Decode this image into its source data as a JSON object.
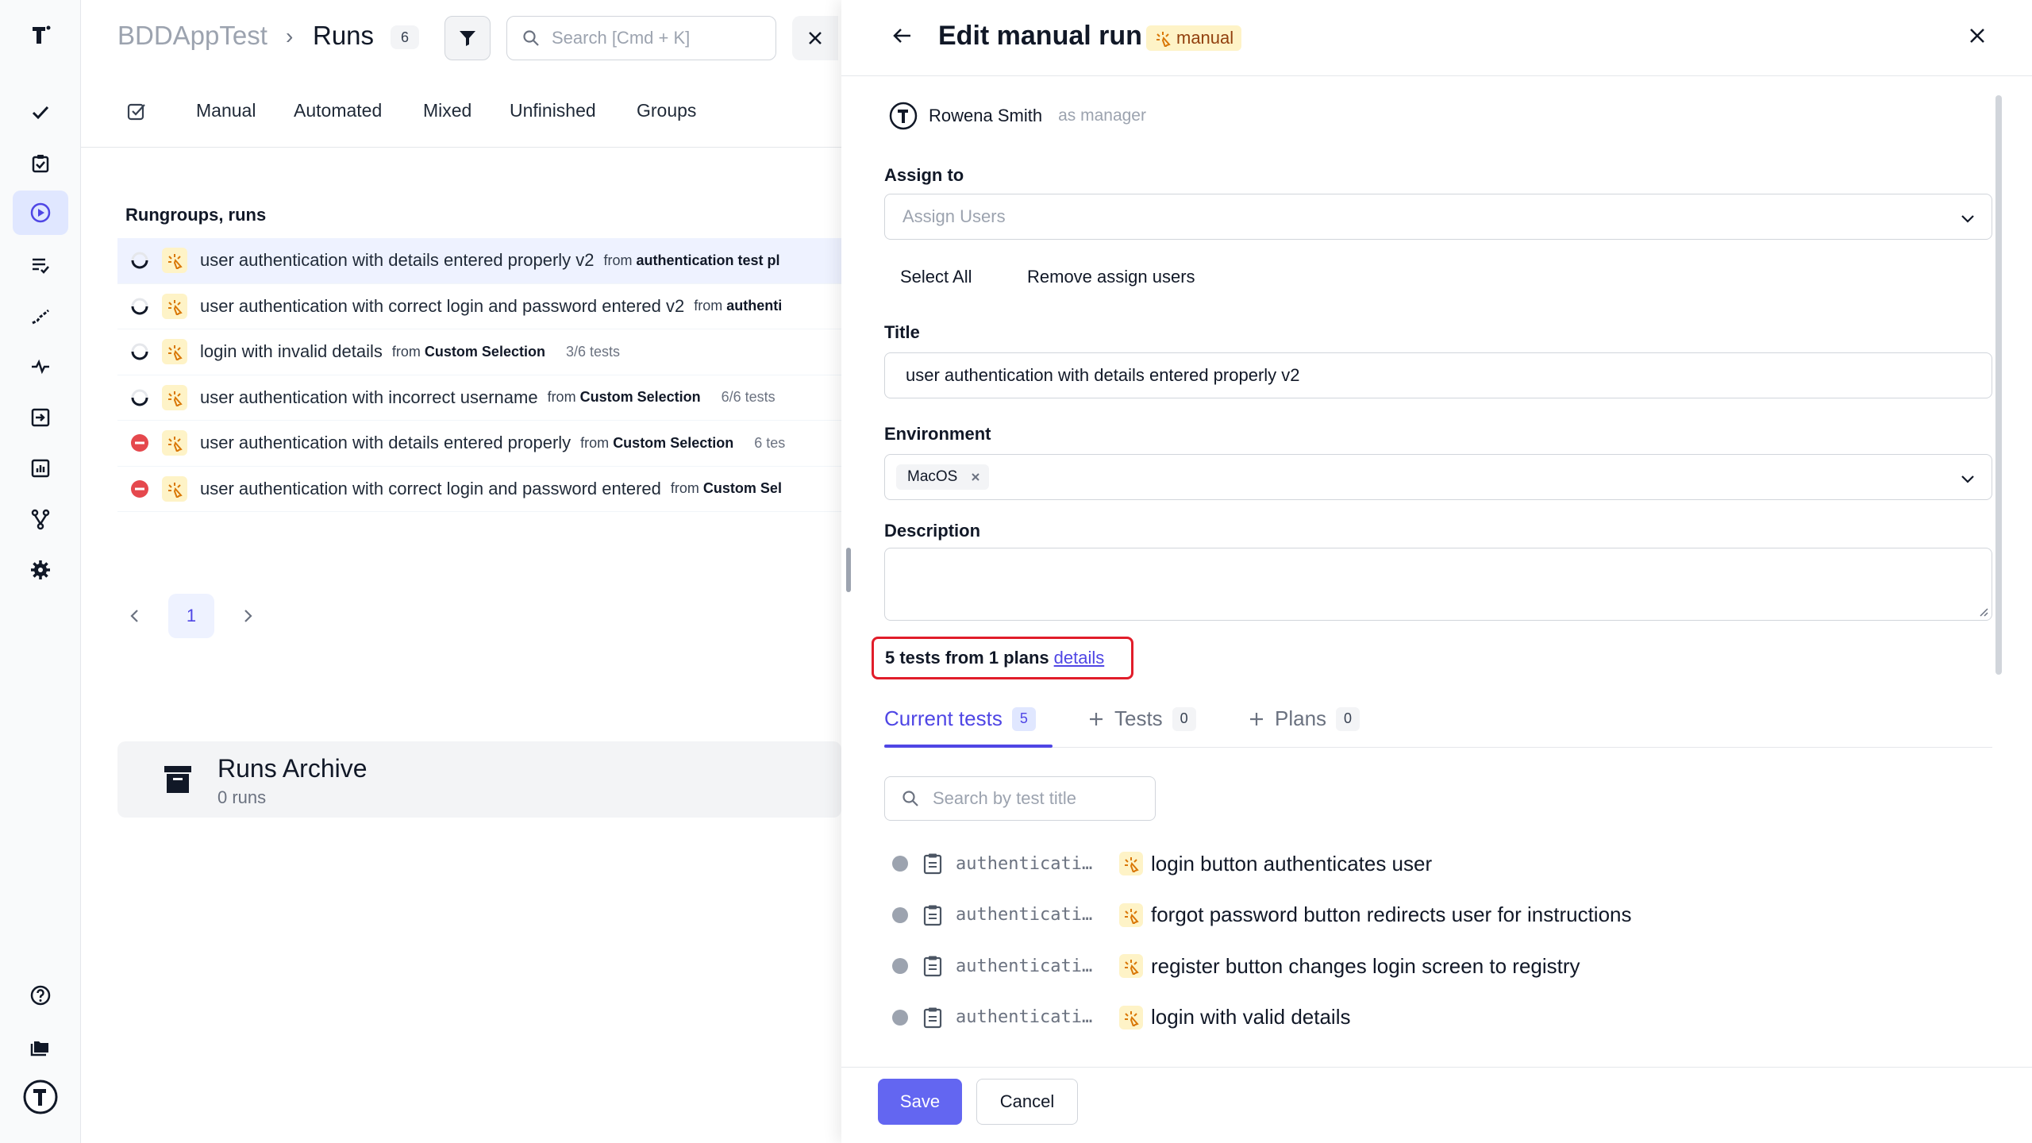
{
  "breadcrumb": {
    "app": "BDDAppTest",
    "separator": "›",
    "page": "Runs",
    "count": "6"
  },
  "search": {
    "placeholder": "Search [Cmd + K]"
  },
  "tabs": [
    "Manual",
    "Automated",
    "Mixed",
    "Unfinished",
    "Groups"
  ],
  "section_title": "Rungroups, runs",
  "runs": [
    {
      "status": "in-progress",
      "title": "user authentication with details entered properly v2",
      "from_label": "from",
      "from": "authentication test pl",
      "tests": "",
      "selected": true
    },
    {
      "status": "in-progress",
      "title": "user authentication with correct login and password entered v2",
      "from_label": "from",
      "from": "authenti",
      "tests": "",
      "selected": false
    },
    {
      "status": "in-progress",
      "title": "login with invalid details",
      "from_label": "from",
      "from": "Custom Selection",
      "tests": "3/6 tests",
      "selected": false
    },
    {
      "status": "in-progress",
      "title": "user authentication with incorrect username",
      "from_label": "from",
      "from": "Custom Selection",
      "tests": "6/6 tests",
      "selected": false
    },
    {
      "status": "failed",
      "title": "user authentication with details entered properly",
      "from_label": "from",
      "from": "Custom Selection",
      "tests": "6 tes",
      "selected": false
    },
    {
      "status": "failed",
      "title": "user authentication with correct login and password entered",
      "from_label": "from",
      "from": "Custom Sel",
      "tests": "",
      "selected": false
    }
  ],
  "pagination": {
    "current": "1"
  },
  "archive": {
    "title": "Runs Archive",
    "subtitle": "0 runs"
  },
  "panel": {
    "title": "Edit manual run",
    "badge": "manual",
    "manager_name": "Rowena Smith",
    "manager_role": "as manager",
    "assign_label": "Assign to",
    "assign_placeholder": "Assign Users",
    "select_all": "Select All",
    "remove_assign": "Remove assign users",
    "title_label": "Title",
    "title_value": "user authentication with details entered properly v2",
    "env_label": "Environment",
    "env_value": "MacOS",
    "description_label": "Description",
    "summary_text": "5 tests from 1 plans",
    "summary_link": "details",
    "tabs": [
      {
        "label": "Current tests",
        "count": "5",
        "active": true
      },
      {
        "label": "Tests",
        "count": "0",
        "active": false
      },
      {
        "label": "Plans",
        "count": "0",
        "active": false
      }
    ],
    "test_search_placeholder": "Search by test title",
    "tests": [
      {
        "suite": "authentication test plan",
        "title": "login button authenticates user"
      },
      {
        "suite": "authentication test plan",
        "title": "forgot password button redirects user for instructions"
      },
      {
        "suite": "authentication test plan",
        "title": "register button changes login screen to registry"
      },
      {
        "suite": "authentication test plan",
        "title": "login with valid details"
      }
    ],
    "save_label": "Save",
    "cancel_label": "Cancel"
  },
  "colors": {
    "accent": "#4f46e5",
    "save": "#6366f1",
    "failed": "#e5484d",
    "highlight": "#e11d2a",
    "manual_bg": "#fef3c7"
  }
}
